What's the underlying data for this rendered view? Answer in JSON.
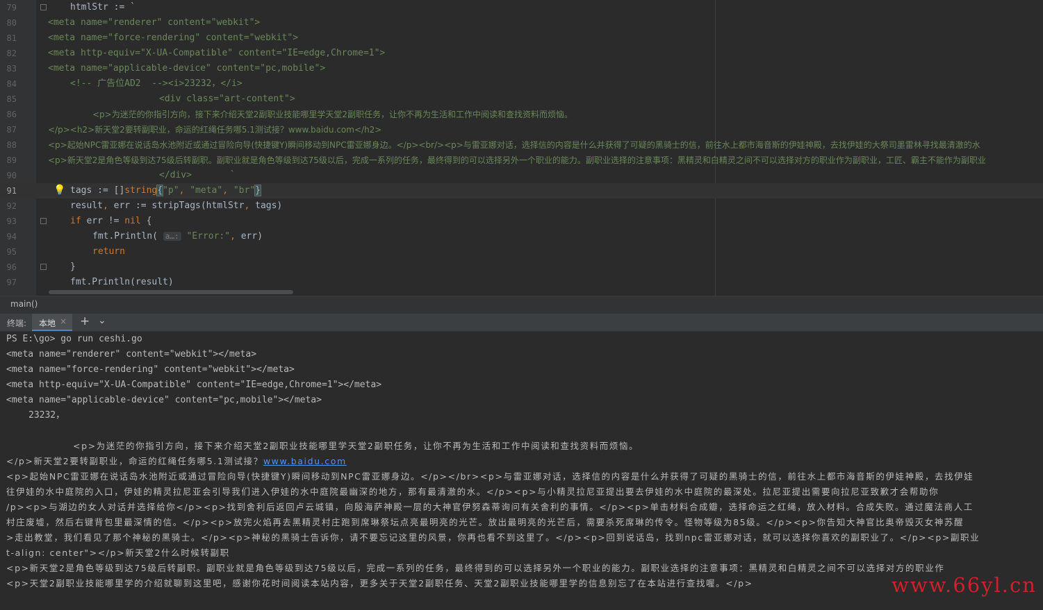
{
  "editor": {
    "lines": [
      {
        "num": "79",
        "indent": 101,
        "fold": true,
        "segments": [
          {
            "t": "htmlStr := `",
            "c": "plain"
          }
        ]
      },
      {
        "num": "80",
        "indent": 69,
        "segments": [
          {
            "t": "<meta name=\"renderer\" content=\"webkit\">",
            "c": "str"
          }
        ]
      },
      {
        "num": "81",
        "indent": 69,
        "segments": [
          {
            "t": "<meta name=\"force-rendering\" content=\"webkit\">",
            "c": "str"
          }
        ]
      },
      {
        "num": "82",
        "indent": 69,
        "segments": [
          {
            "t": "<meta http-equiv=\"X-UA-Compatible\" content=\"IE=edge,Chrome=1\">",
            "c": "str"
          }
        ]
      },
      {
        "num": "83",
        "indent": 69,
        "segments": [
          {
            "t": "<meta name=\"applicable-device\" content=\"pc,mobile\">",
            "c": "str"
          }
        ]
      },
      {
        "num": "84",
        "indent": 101,
        "segments": [
          {
            "t": "<!-- 广告位AD2  --><i>23232，</i>",
            "c": "str"
          }
        ]
      },
      {
        "num": "85",
        "indent": 229,
        "segments": [
          {
            "t": "<div class=\"art-content\">",
            "c": "str"
          }
        ]
      },
      {
        "num": "86",
        "indent": 133,
        "cjk": true,
        "segments": [
          {
            "t": "<p>为迷茫的你指引方向，接下来介绍天堂2副职业技能哪里学天堂2副职任务，让你不再为生活和工作中阅读和查找资料而烦恼。",
            "c": "str"
          }
        ]
      },
      {
        "num": "87",
        "indent": 69,
        "cjk": true,
        "segments": [
          {
            "t": "</p><h2>新天堂2要转副职业，命运的红绳任务哪5.1测试接？www.baidu.com</h2>",
            "c": "str"
          }
        ]
      },
      {
        "num": "88",
        "indent": 69,
        "cjk": true,
        "segments": [
          {
            "t": "<p>起始NPC雷亚娜在说话岛水池附近或通过冒险向导(快捷键Y)瞬间移动到NPC雷亚娜身边。</p><br/><p>与雷亚娜对话，选择信的内容是什么并获得了可疑的黑骑士的信，前往水上都市海音斯的伊娃神殿，去找伊娃的大祭司墨雷林寻找最清澈的水",
            "c": "str"
          }
        ]
      },
      {
        "num": "89",
        "indent": 69,
        "cjk": true,
        "segments": [
          {
            "t": "<p>新天堂2是角色等级到达75级后转副职。副职业就是角色等级到达75级以后，完成一系列的任务，最终得到的可以选择另外一个职业的能力。副职业选择的注意事项：黑精灵和白精灵之间不可以选择对方的职业作为副职业，工匠、霸主不能作为副职业",
            "c": "str"
          }
        ]
      },
      {
        "num": "90",
        "indent": 229,
        "segments": [
          {
            "t": "</div>       `",
            "c": "str"
          }
        ]
      },
      {
        "num": "91",
        "indent": 101,
        "current": true,
        "bulb": true,
        "segments": [
          {
            "t": "tags := []",
            "c": "plain"
          },
          {
            "t": "string",
            "c": "kw"
          },
          {
            "t": "{",
            "c": "brace"
          },
          {
            "t": "\"p\"",
            "c": "str"
          },
          {
            "t": ", ",
            "c": "kw"
          },
          {
            "t": "\"meta\"",
            "c": "str"
          },
          {
            "t": ", ",
            "c": "kw"
          },
          {
            "t": "\"br\"",
            "c": "str"
          },
          {
            "t": "}",
            "c": "brace"
          }
        ]
      },
      {
        "num": "92",
        "indent": 101,
        "segments": [
          {
            "t": "result",
            "c": "plain"
          },
          {
            "t": ", ",
            "c": "kw"
          },
          {
            "t": "err := stripTags(htmlStr",
            "c": "plain"
          },
          {
            "t": ", ",
            "c": "kw"
          },
          {
            "t": "tags)",
            "c": "plain"
          }
        ]
      },
      {
        "num": "93",
        "indent": 101,
        "fold": true,
        "segments": [
          {
            "t": "if ",
            "c": "kw"
          },
          {
            "t": "err != ",
            "c": "plain"
          },
          {
            "t": "nil",
            "c": "kw"
          },
          {
            "t": " {",
            "c": "plain"
          }
        ]
      },
      {
        "num": "94",
        "indent": 133,
        "segments": [
          {
            "t": "fmt.Println( ",
            "c": "plain"
          },
          {
            "t": "a…:",
            "c": "hint"
          },
          {
            "t": " \"Error:\"",
            "c": "str"
          },
          {
            "t": ", ",
            "c": "kw"
          },
          {
            "t": "err)",
            "c": "plain"
          }
        ]
      },
      {
        "num": "95",
        "indent": 133,
        "segments": [
          {
            "t": "return",
            "c": "kw"
          }
        ]
      },
      {
        "num": "96",
        "indent": 101,
        "fold": true,
        "segments": [
          {
            "t": "}",
            "c": "plain"
          }
        ]
      },
      {
        "num": "97",
        "indent": 101,
        "segments": [
          {
            "t": "fmt.Println(result)",
            "c": "plain"
          }
        ]
      }
    ],
    "bulb_icon": "lightbulb-icon"
  },
  "breadcrumb": {
    "label": "main()"
  },
  "terminal_bar": {
    "label": "终端:",
    "tab_label": "本地",
    "tab_close": "×",
    "add_label": "+",
    "more_label": "⌄"
  },
  "terminal": {
    "lines": [
      {
        "indent": 9,
        "text": "PS E:\\go> go run ceshi.go"
      },
      {
        "indent": 9,
        "text": "<meta name=\"renderer\" content=\"webkit\"></meta>"
      },
      {
        "indent": 9,
        "text": "<meta name=\"force-rendering\" content=\"webkit\"></meta>"
      },
      {
        "indent": 9,
        "text": "<meta http-equiv=\"X-UA-Compatible\" content=\"IE=edge,Chrome=1\"></meta>"
      },
      {
        "indent": 9,
        "text": "<meta name=\"applicable-device\" content=\"pc,mobile\"></meta>"
      },
      {
        "indent": 41,
        "text": "23232，"
      },
      {
        "indent": 9,
        "text": ""
      },
      {
        "indent": 105,
        "cjk": true,
        "text": "<p>为迷茫的你指引方向，接下来介绍天堂2副职业技能哪里学天堂2副职任务，让你不再为生活和工作中阅读和查找资料而烦恼。"
      },
      {
        "indent": 9,
        "cjk": true,
        "text": "</p>新天堂2要转副职业，命运的红绳任务哪5.1测试接？",
        "link": "www.baidu.com"
      },
      {
        "indent": 9,
        "cjk": true,
        "text": "<p>起始NPC雷亚娜在说话岛水池附近或通过冒险向导(快捷键Y)瞬间移动到NPC雷亚娜身边。</p></br><p>与雷亚娜对话，选择信的内容是什么并获得了可疑的黑骑士的信，前往水上都市海音斯的伊娃神殿，去找伊娃"
      },
      {
        "indent": 9,
        "cjk": true,
        "text": "往伊娃的水中庭院的入口，伊娃的精灵拉尼亚会引导我们进入伊娃的水中庭院最幽深的地方，那有最清澈的水。</p><p>与小精灵拉尼亚提出要去伊娃的水中庭院的最深处。拉尼亚提出需要向拉尼亚致歉才会帮助你"
      },
      {
        "indent": 9,
        "cjk": true,
        "text": "/p><p>与湖边的女人对话并选择给你</p><p>找到舍利后返回卢云城镇，向殷海萨神殿一层的大神官伊努森蒂询问有关舍利的事情。</p><p>单击材料合成瓣，选择命运之红绳，放入材料。合成失败。通过魔法商人工"
      },
      {
        "indent": 9,
        "cjk": true,
        "text": "村庄废墟，然后右键背包里最深情的信。</p><p>放完火焰再去黑精灵村庄跑到席琳祭坛点亮最明亮的光芒。放出最明亮的光芒后，需要杀死席琳的传令。怪物等级为85级。</p><p>你告知大神官比奥帝毁灭女神苏醒"
      },
      {
        "indent": 9,
        "cjk": true,
        "text": ">走出教堂，我们看见了那个神秘的黑骑士。</p><p>神秘的黑骑士告诉你，请不要忘记这里的风景，你再也看不到这里了。</p><p>回到说话岛，找到npc雷亚娜对话，就可以选择你喜欢的副职业了。</p><p>副职业"
      },
      {
        "indent": 9,
        "cjk": true,
        "text": "t-align: center\"></p>新天堂2什么时候转副职"
      },
      {
        "indent": 9,
        "cjk": true,
        "text": "<p>新天堂2是角色等级到达75级后转副职。副职业就是角色等级到达75级以后，完成一系列的任务，最终得到的可以选择另外一个职业的能力。副职业选择的注意事项：黑精灵和白精灵之间不可以选择对方的职业作"
      },
      {
        "indent": 9,
        "cjk": true,
        "text": "<p>天堂2副职业技能哪里学的介绍就聊到这里吧，感谢你花时间阅读本站内容，更多关于天堂2副职任务、天堂2副职业技能哪里学的信息别忘了在本站进行查找喔。</p>"
      }
    ]
  },
  "watermark": {
    "text": "www.66yl.cn"
  },
  "colors": {
    "editor_bg": "#2b2b2b",
    "gutter_bg": "#313335",
    "string": "#6a8759",
    "keyword": "#cc7832",
    "plain": "#a9b7c6",
    "link": "#5394ec",
    "watermark": "#d0202a",
    "tab_underline": "#4a88c7"
  }
}
